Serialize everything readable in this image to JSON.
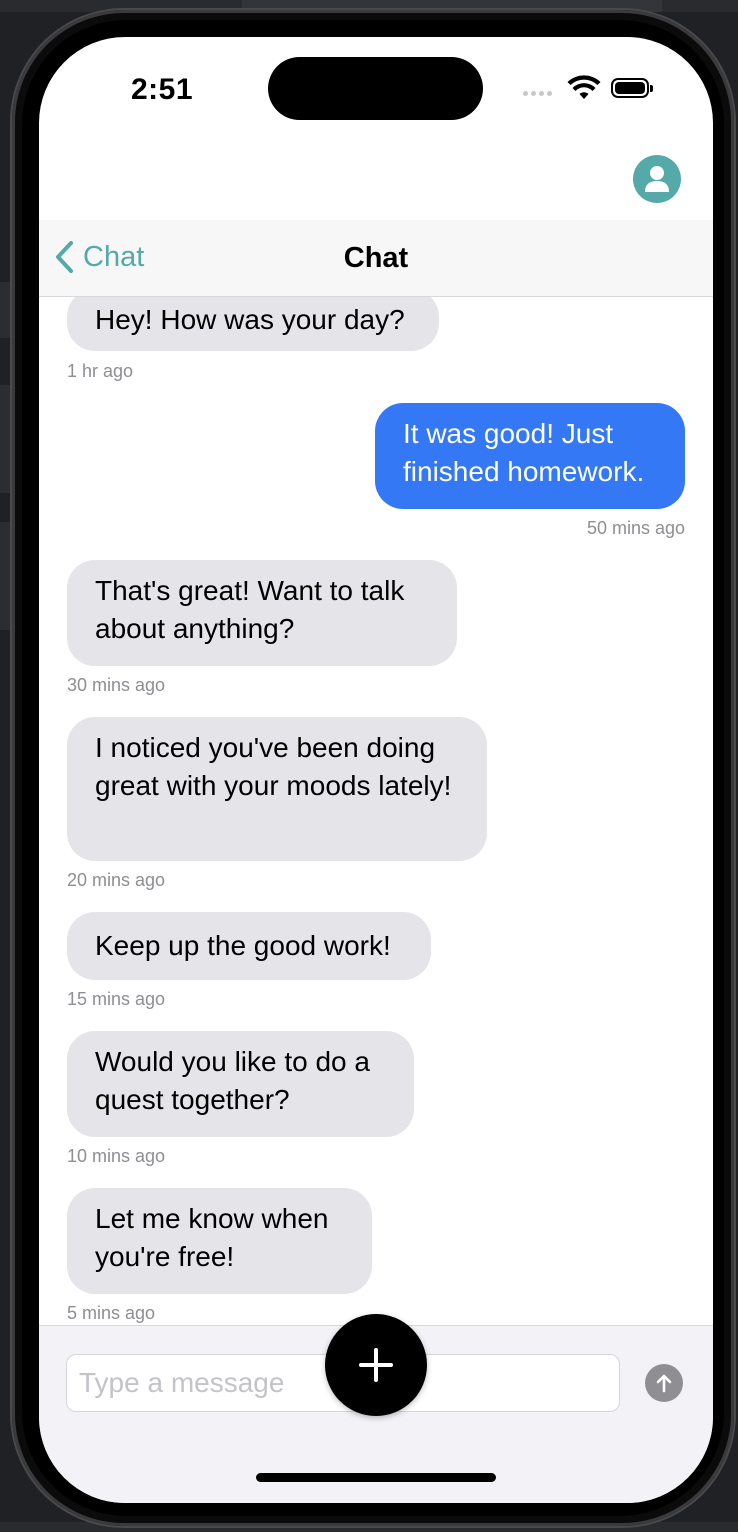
{
  "status_bar": {
    "time": "2:51"
  },
  "nav": {
    "back_label": "Chat",
    "title": "Chat"
  },
  "messages": [
    {
      "text": "Hey! How was your day?",
      "time": "1 hr ago",
      "side": "incoming"
    },
    {
      "text": "It was good! Just finished homework.",
      "time": "50 mins ago",
      "side": "outgoing"
    },
    {
      "text": "That's great! Want to talk about anything?",
      "time": "30 mins ago",
      "side": "incoming"
    },
    {
      "text": "I noticed you've been doing great with your moods lately!",
      "time": "20 mins ago",
      "side": "incoming"
    },
    {
      "text": "Keep up the good work!",
      "time": "15 mins ago",
      "side": "incoming"
    },
    {
      "text": "Would you like to do a quest together?",
      "time": "10 mins ago",
      "side": "incoming"
    },
    {
      "text": "Let me know when you're free!",
      "time": "5 mins ago",
      "side": "incoming"
    }
  ],
  "composer": {
    "placeholder": "Type a message"
  },
  "icons": {
    "avatar": "person-icon",
    "back": "chevron-left-icon",
    "send": "arrow-up-icon",
    "fab": "plus-icon",
    "wifi": "wifi-icon",
    "battery": "battery-icon"
  },
  "colors": {
    "accent": "#55aaa9",
    "outgoing_bubble": "#3478f6",
    "incoming_bubble": "#e4e4e9",
    "timestamp": "#8e8e93"
  }
}
